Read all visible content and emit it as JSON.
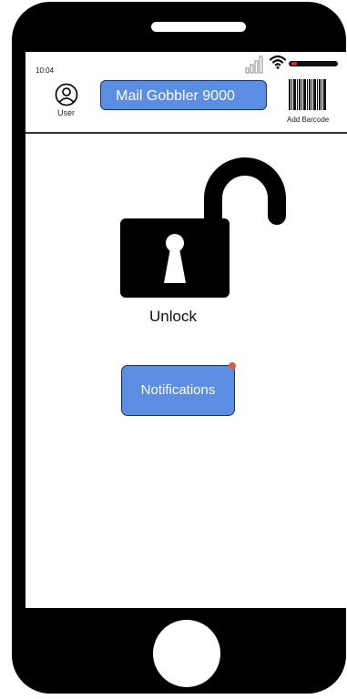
{
  "status_bar": {
    "time": "10:04"
  },
  "header": {
    "user_label": "User",
    "app_title": "Mail Gobbler 9000",
    "barcode_label": "Add Barcode"
  },
  "main": {
    "unlock_label": "Unlock",
    "notifications_label": "Notifications"
  },
  "icons": {
    "user": "user-circle",
    "barcode": "barcode",
    "lock": "unlocked-padlock",
    "signal": "cellular-signal",
    "wifi": "wifi",
    "battery": "battery-low"
  },
  "colors": {
    "button_fill": "#5b8ee3",
    "button_border": "#17356d",
    "notification_dot": "#dd5c3c",
    "battery_indicator": "#e03030"
  }
}
